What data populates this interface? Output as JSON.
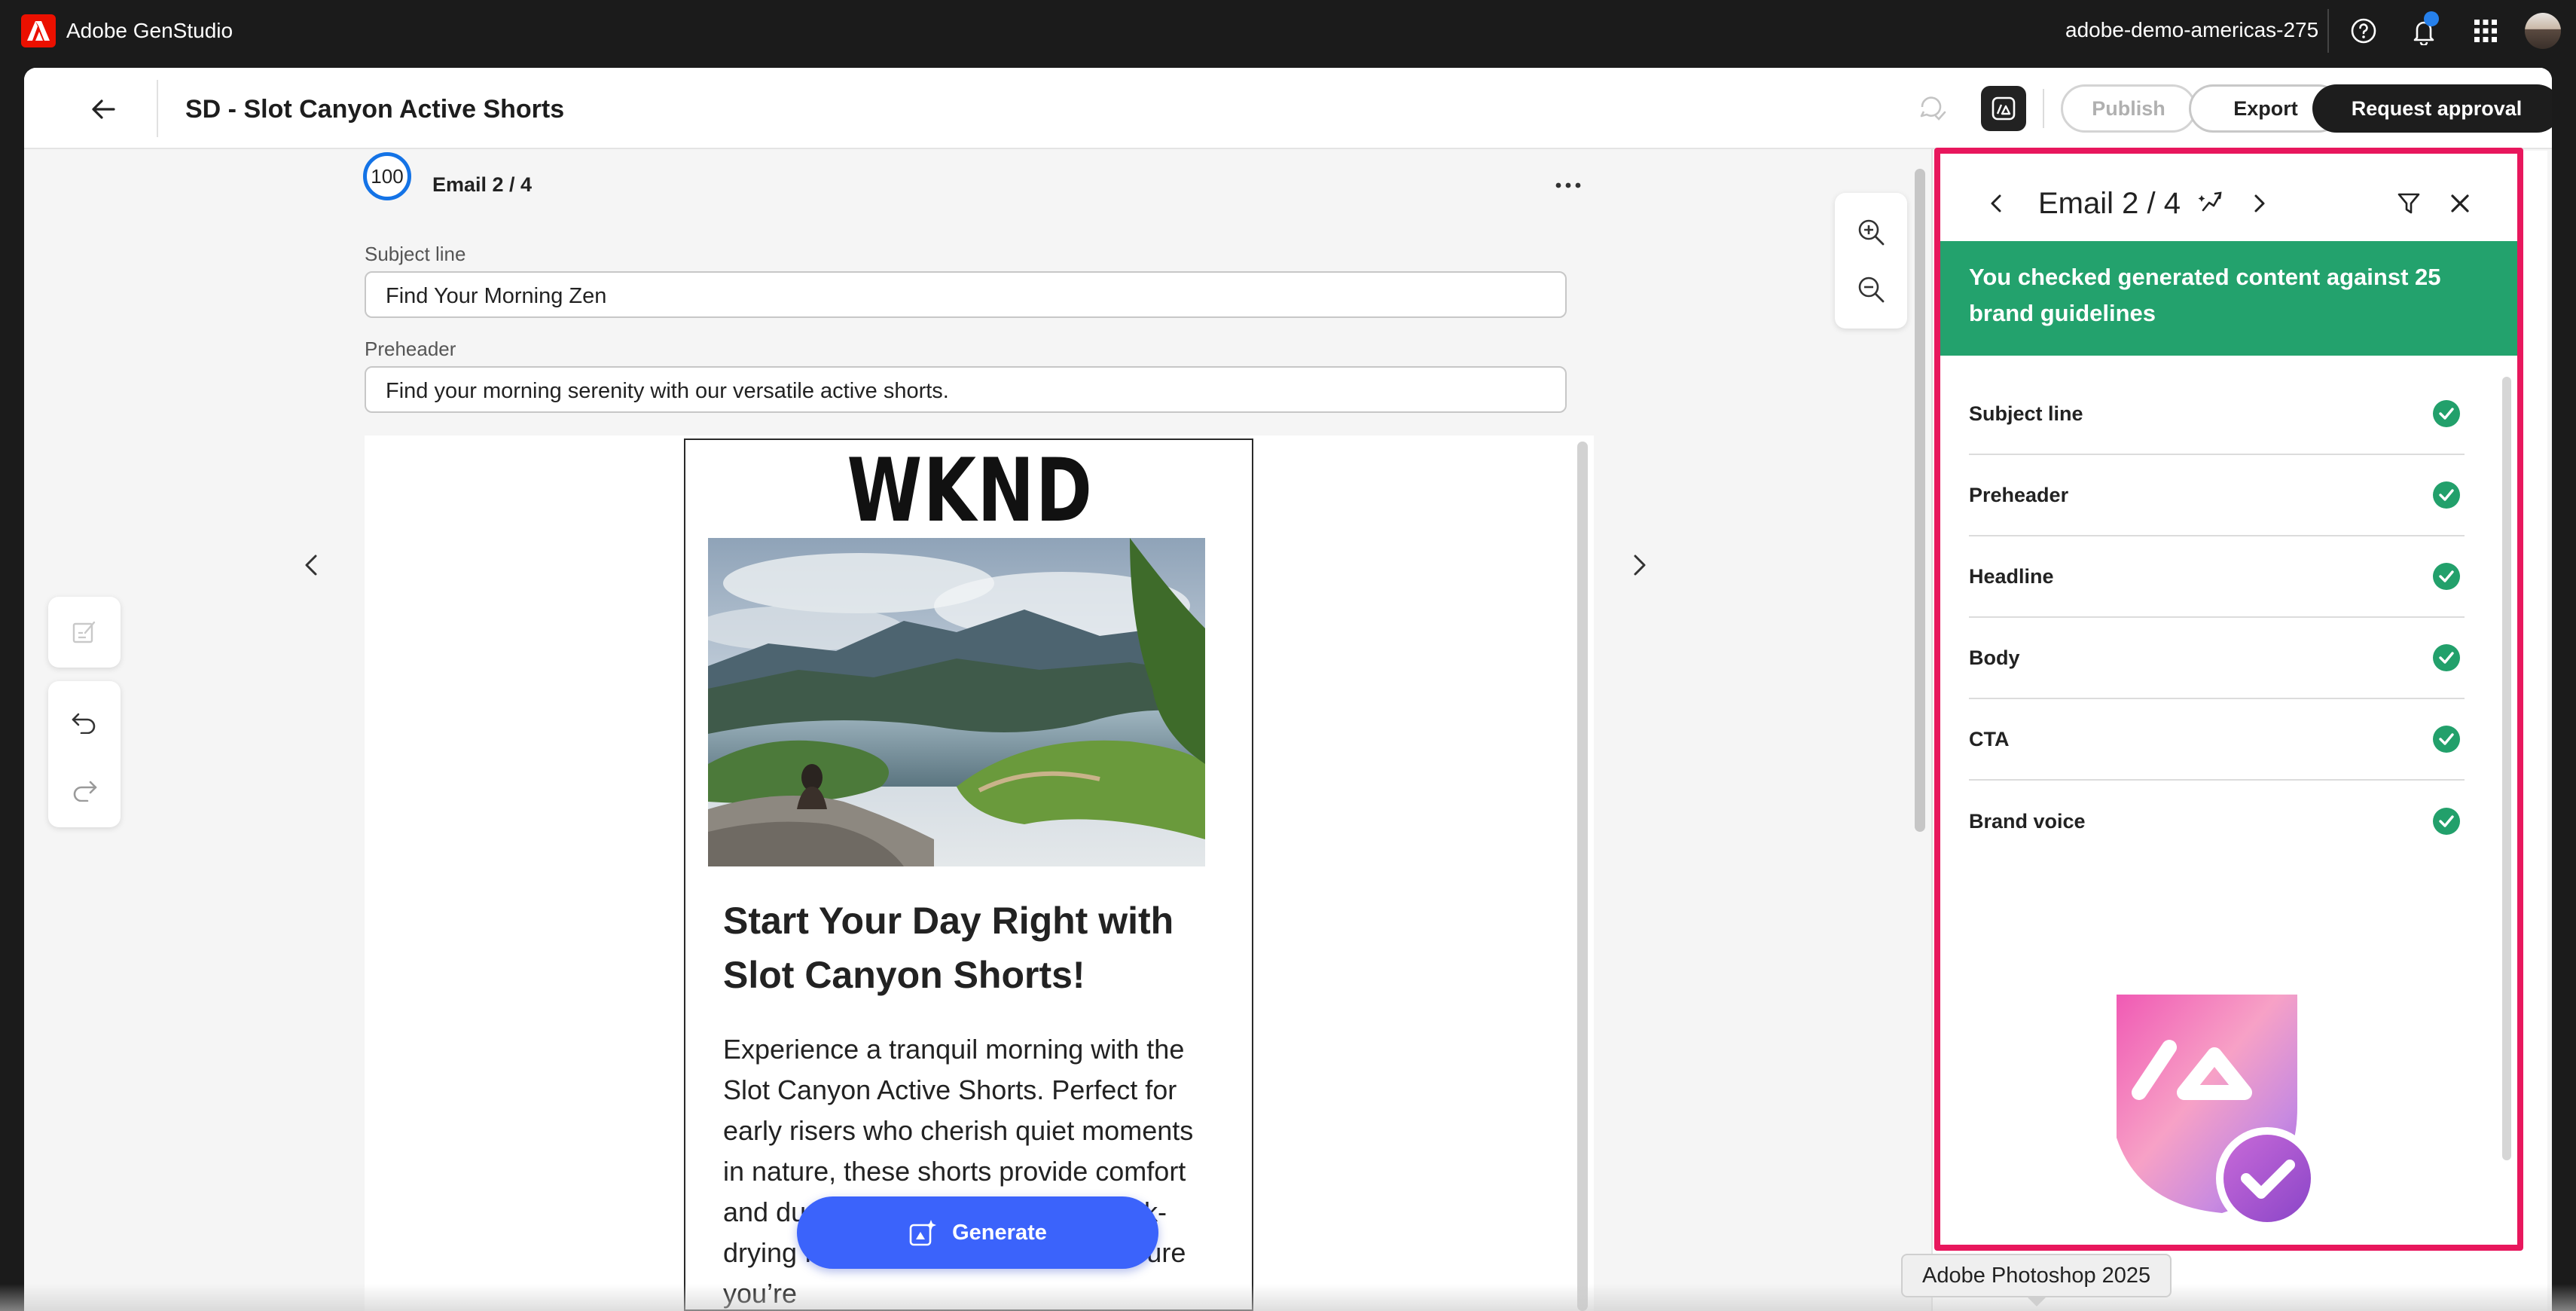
{
  "system": {
    "app_name": "Adobe GenStudio",
    "org_name": "adobe-demo-americas-275",
    "icons": [
      "help-icon",
      "bell-icon",
      "app-grid-icon"
    ]
  },
  "header": {
    "title": "SD - Slot Canyon Active Shorts",
    "publish_label": "Publish",
    "export_label": "Export",
    "request_approval_label": "Request approval"
  },
  "variant": {
    "score": "100",
    "label": "Email 2 / 4"
  },
  "fields": {
    "subject_label": "Subject line",
    "subject_value": "Find Your Morning Zen",
    "preheader_label": "Preheader",
    "preheader_value": "Find your morning serenity with our versatile active shorts."
  },
  "email": {
    "brand_logo": "WKND",
    "headline": "Start Your Day Right with Slot Canyon Shorts!",
    "body": "Experience a tranquil morning with the Slot Canyon Active Shorts. Perfect for early risers who cherish quiet moments in nature, these shorts provide comfort and durability. The breathable, quick-drying fabric and UV protection ensure you’re"
  },
  "generate_label": "Generate",
  "panel": {
    "title": "Email 2 / 4",
    "banner": "You checked generated content against 25 brand guidelines",
    "checks": [
      {
        "label": "Subject line",
        "status": "passed"
      },
      {
        "label": "Preheader",
        "status": "passed"
      },
      {
        "label": "Headline",
        "status": "passed"
      },
      {
        "label": "Body",
        "status": "passed"
      },
      {
        "label": "CTA",
        "status": "passed"
      },
      {
        "label": "Brand voice",
        "status": "passed"
      }
    ]
  },
  "tooltip": "Adobe Photoshop 2025",
  "colors": {
    "accent_blue": "#3b63fb",
    "success_green": "#23a26d",
    "highlight_pink": "#e8175d",
    "adobe_red": "#eb1000"
  }
}
